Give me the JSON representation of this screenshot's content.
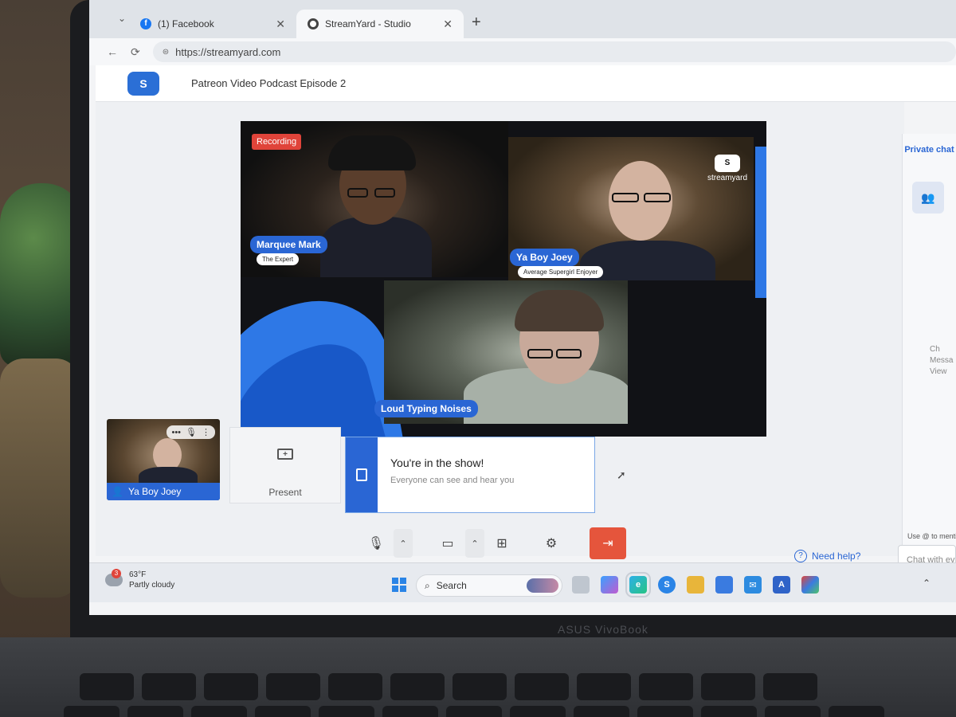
{
  "browser": {
    "tabs": [
      {
        "label": "(1) Facebook",
        "icon": "facebook-icon"
      },
      {
        "label": "StreamYard - Studio",
        "icon": "streamyard-icon"
      }
    ],
    "url": "https://streamyard.com"
  },
  "header": {
    "logo_text": "S",
    "title": "Patreon Video Podcast Episode 2"
  },
  "stage": {
    "recording_label": "Recording",
    "brand_label": "streamyard",
    "participants": [
      {
        "name": "Marquee Mark",
        "subtitle": "The Expert"
      },
      {
        "name": "Ya Boy Joey",
        "subtitle": "Average Supergirl Enjoyer"
      },
      {
        "name": "Loud Typing Noises",
        "subtitle": ""
      }
    ]
  },
  "self_preview": {
    "name": "Ya Boy Joey"
  },
  "present": {
    "label": "Present"
  },
  "notice": {
    "title": "You're in the show!",
    "subtitle": "Everyone can see and hear you"
  },
  "controls": {
    "mic": "microphone-icon",
    "camera": "camera-icon",
    "share": "screen-share-icon",
    "settings": "gear-icon",
    "leave": "leave-studio-icon"
  },
  "help_label": "Need help?",
  "chat": {
    "tab_label": "Private chat",
    "empty_lines": [
      "Ch",
      "Messa",
      "View"
    ],
    "hint": "Use @ to mention",
    "input_placeholder": "Chat with eve"
  },
  "taskbar": {
    "weather_badge": "3",
    "temperature": "63°F",
    "condition": "Partly cloudy",
    "search_label": "Search"
  },
  "laptop": {
    "brand": "ASUS VivoBook"
  },
  "colors": {
    "accent": "#2a66d4",
    "leave": "#e5553c",
    "recording": "#e0443a"
  }
}
